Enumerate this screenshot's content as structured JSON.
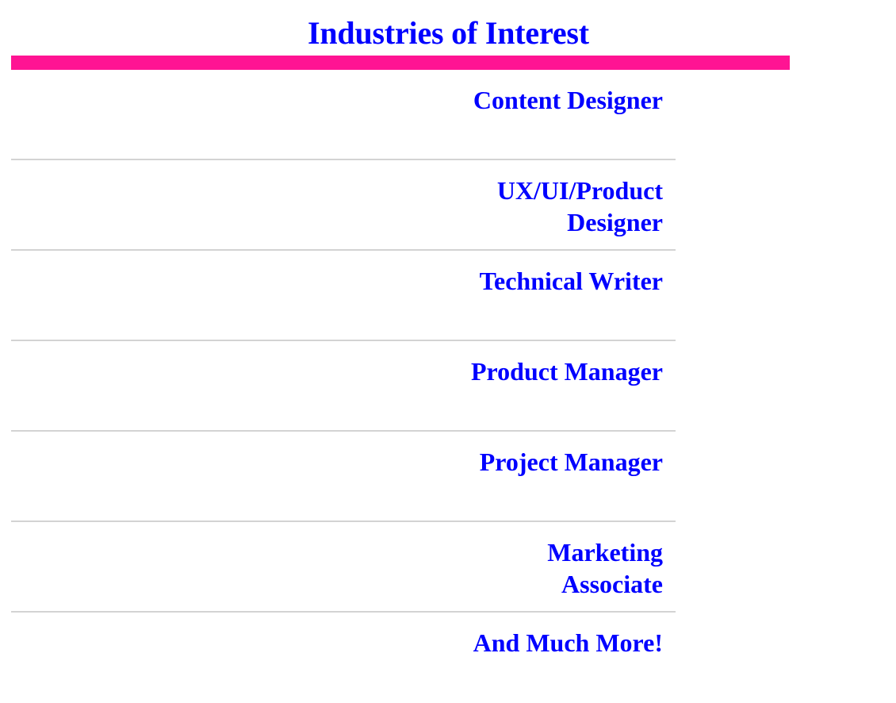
{
  "header": {
    "title": "Industries of Interest"
  },
  "industries": [
    {
      "label": "Content Designer"
    },
    {
      "label": "UX/UI/Product Designer"
    },
    {
      "label": "Technical Writer"
    },
    {
      "label": "Product Manager"
    },
    {
      "label": "Project Manager"
    },
    {
      "label": "Marketing Associate"
    },
    {
      "label": "And Much More!"
    }
  ],
  "colors": {
    "title": "#0000ff",
    "accent_rule": "#ff1493",
    "divider": "#d3d3d3",
    "link": "#0000ff"
  }
}
